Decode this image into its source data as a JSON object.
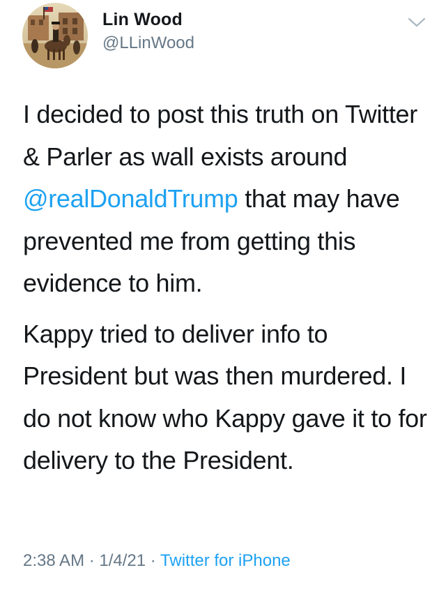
{
  "author": {
    "display_name": "Lin Wood",
    "handle": "@LLinWood",
    "avatar_icon": "western-painting-avatar"
  },
  "menu": {
    "icon": "chevron-down-icon"
  },
  "tweet": {
    "para1_part1": "I decided to post this truth on Twitter & Parler as wall exists around ",
    "mention": "@realDonaldTrump",
    "para1_part2": " that may have prevented me from getting this evidence to him.",
    "para2": "Kappy tried to deliver info to President but was then murdered. I do not know who Kappy gave it to for delivery to the President."
  },
  "meta": {
    "time": "2:38 AM",
    "separator1": " · ",
    "date": "1/4/21",
    "separator2": " · ",
    "source": "Twitter for iPhone"
  },
  "colors": {
    "link": "#1da1f2",
    "secondary_text": "#657786",
    "primary_text": "#14171a"
  }
}
